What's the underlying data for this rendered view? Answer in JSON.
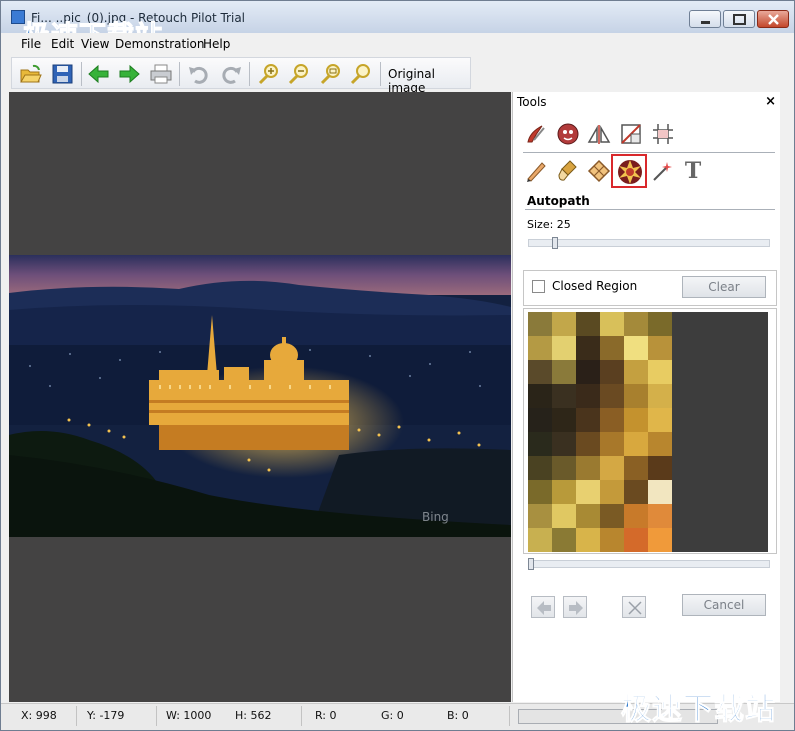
{
  "window": {
    "title": "Fi... ..pic_(0).jpg - Retouch Pilot Trial",
    "watermark_top": "极速下载站",
    "watermark_bottom": "极速下载站"
  },
  "menu": [
    "File",
    "Edit",
    "View",
    "Demonstration",
    "Help"
  ],
  "toolbar": {
    "buttons": [
      "open-icon",
      "save-icon",
      "back-arrow-icon",
      "forward-arrow-icon",
      "print-icon",
      "undo-icon",
      "redo-icon",
      "zoom-in-icon",
      "zoom-out-icon",
      "zoom-fit-icon",
      "zoom-actual-icon"
    ],
    "original_image_label": "Original image"
  },
  "canvas": {
    "photo_credit": "Bing"
  },
  "tools_panel": {
    "title": "Tools",
    "close_label": "×",
    "row1_icons": [
      "brush-icon",
      "face-icon",
      "mirror-icon",
      "crop-icon",
      "grid-icon"
    ],
    "row2_icons": [
      "pencil-icon",
      "eraser-brush-icon",
      "patch-icon",
      "autopath-icon",
      "wand-icon",
      "text-icon"
    ],
    "text_tool_glyph": "T",
    "selected_tool": "autopath-icon",
    "section_title": "Autopath",
    "size_label": "Size: 25",
    "size_value": 25,
    "closed_region_label": "Closed Region",
    "closed_region_checked": false,
    "clear_label": "Clear",
    "cancel_label": "Cancel"
  },
  "statusbar": {
    "x": "X: 998",
    "y": "Y: -179",
    "w": "W: 1000",
    "h": "H: 562",
    "r": "R: 0",
    "g": "G: 0",
    "b": "B: 0"
  },
  "colors": {
    "accent_selection": "#d9282c",
    "watermark": "#1f6fc8",
    "canvas_bg": "#444343"
  }
}
